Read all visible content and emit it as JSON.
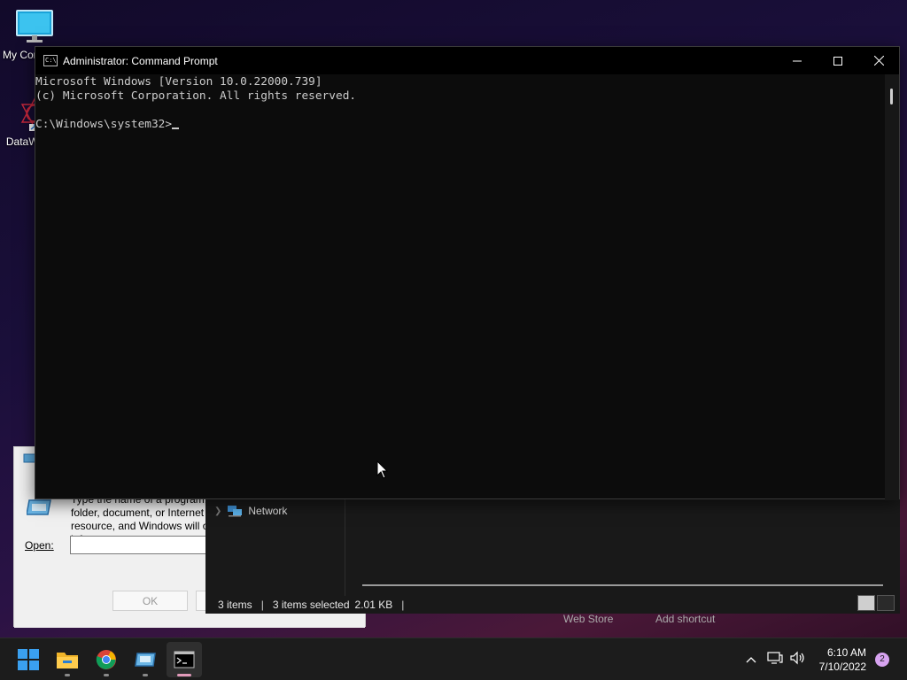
{
  "desktop": {
    "icons": [
      {
        "label": "My Computer",
        "icon": "monitor-icon"
      },
      {
        "label": "DataWarrior",
        "icon": "datawarrior-icon"
      }
    ]
  },
  "run_dialog": {
    "description": "Type the name of a program, folder, document, or Internet resource, and Windows will open it for you.",
    "open_label": "Open:",
    "open_value": "",
    "ok_label": "OK"
  },
  "explorer": {
    "nav_network": "Network",
    "status_items": "3 items",
    "status_selected": "3 items selected",
    "status_size": "2.01 KB",
    "peek_webstore": "Web Store",
    "peek_shortcut": "Add shortcut"
  },
  "cmd": {
    "title": "Administrator: Command Prompt",
    "lines": [
      "Microsoft Windows [Version 10.0.22000.739]",
      "(c) Microsoft Corporation. All rights reserved.",
      "",
      "C:\\Windows\\system32>"
    ]
  },
  "taskbar": {
    "apps": [
      "start-icon",
      "file-explorer-icon",
      "chrome-icon",
      "run-icon",
      "terminal-icon"
    ],
    "time": "6:10 AM",
    "date": "7/10/2022",
    "notifications": "2"
  },
  "colors": {
    "console_bg": "#0c0c0c",
    "console_fg": "#cccccc",
    "accent": "#e29aba"
  }
}
